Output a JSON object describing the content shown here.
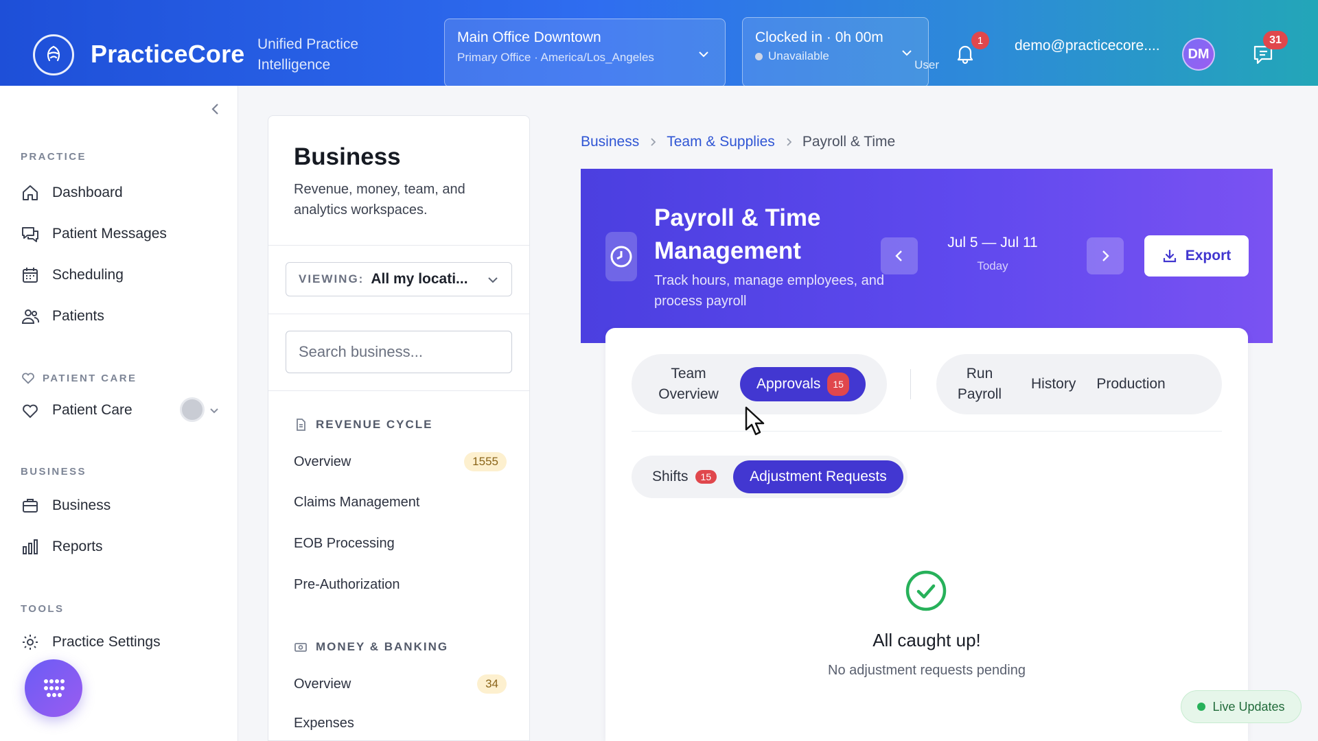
{
  "header": {
    "brand_name": "PracticeCore",
    "brand_tagline": "Unified Practice Intelligence",
    "location": {
      "title": "Main Office Downtown",
      "subtitle": "Primary Office · America/Los_Angeles"
    },
    "clock": {
      "title": "Clocked in · 0h 00m",
      "status": "Unavailable"
    },
    "notifications_count": "1",
    "user_email": "demo@practicecore....",
    "user_role": "User",
    "avatar_initials": "DM",
    "messages_count": "31"
  },
  "sidebar": {
    "sections": {
      "practice": "PRACTICE",
      "patient_care": "PATIENT CARE",
      "business": "BUSINESS",
      "tools": "TOOLS"
    },
    "items": {
      "dashboard": "Dashboard",
      "patient_messages": "Patient Messages",
      "scheduling": "Scheduling",
      "patients": "Patients",
      "patient_care": "Patient Care",
      "business": "Business",
      "reports": "Reports",
      "practice_settings": "Practice Settings"
    }
  },
  "midpanel": {
    "title": "Business",
    "description": "Revenue, money, team, and analytics workspaces.",
    "viewing_label": "VIEWING:",
    "viewing_value": "All my locati...",
    "search_placeholder": "Search business...",
    "groups": {
      "revenue_cycle": {
        "label": "REVENUE CYCLE",
        "items": [
          "Overview",
          "Claims Management",
          "EOB Processing",
          "Pre-Authorization"
        ],
        "overview_count": "1555"
      },
      "money_banking": {
        "label": "MONEY & BANKING",
        "items": [
          "Overview",
          "Expenses"
        ],
        "overview_count": "34"
      }
    }
  },
  "breadcrumb": [
    "Business",
    "Team & Supplies",
    "Payroll & Time"
  ],
  "hero": {
    "title": "Payroll & Time Management",
    "description": "Track hours, manage employees, and process payroll",
    "range": "Jul 5 — Jul 11",
    "range_sub": "Today",
    "export_label": "Export"
  },
  "tabs": {
    "team_overview": "Team Overview",
    "approvals": "Approvals",
    "approvals_count": "15",
    "run_payroll": "Run Payroll",
    "history": "History",
    "production": "Production"
  },
  "subtabs": {
    "shifts": "Shifts",
    "shifts_count": "15",
    "adjustment_requests": "Adjustment Requests"
  },
  "empty_state": {
    "title": "All caught up!",
    "subtitle": "No adjustment requests pending"
  },
  "live_updates": "Live Updates",
  "colors": {
    "accent": "#4237d1",
    "badge_red": "#e0474c",
    "success_green": "#27b15a"
  }
}
